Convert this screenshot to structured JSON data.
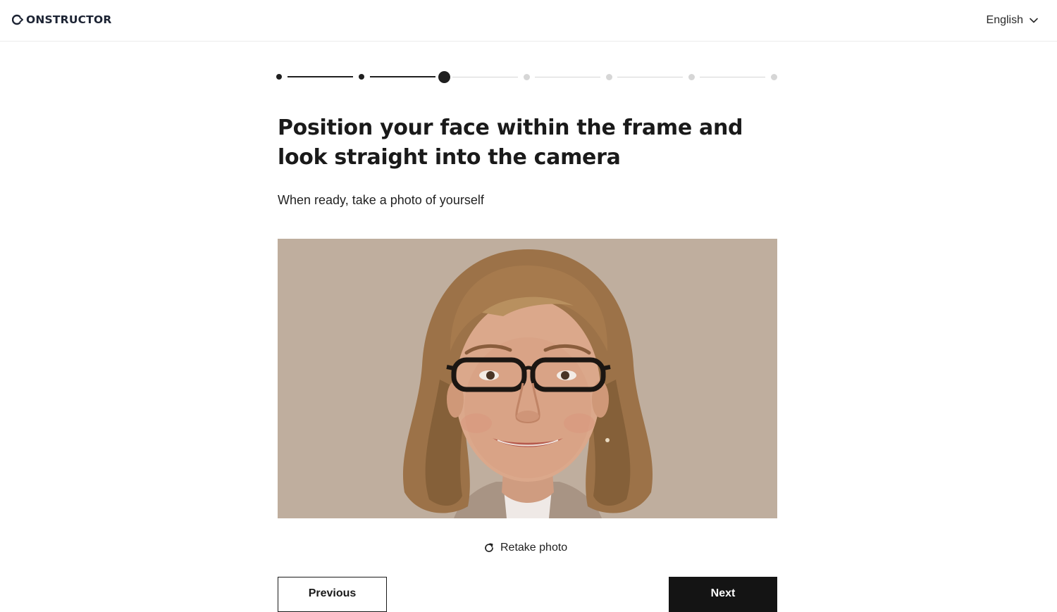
{
  "header": {
    "logo_text": "ONSTRUCTOR",
    "language": "English",
    "icons": {
      "logo": "constructor-logo-icon",
      "dropdown": "chevron-down-icon"
    }
  },
  "stepper": {
    "total_steps": 7,
    "current_step": 3,
    "colors": {
      "done": "#1f1f1f",
      "pending": "#d6d6d6"
    }
  },
  "content": {
    "title": "Position your face within the frame and look straight into the camera",
    "subtitle": "When ready, take a photo of yourself"
  },
  "photo": {
    "background_color": "#bfae9e",
    "alt": "Captured selfie photo"
  },
  "actions": {
    "retake_label": "Retake photo",
    "retake_icon": "refresh-icon",
    "previous_label": "Previous",
    "next_label": "Next"
  },
  "colors": {
    "primary": "#141414",
    "text": "#1a1a1a",
    "border": "#ececec"
  }
}
